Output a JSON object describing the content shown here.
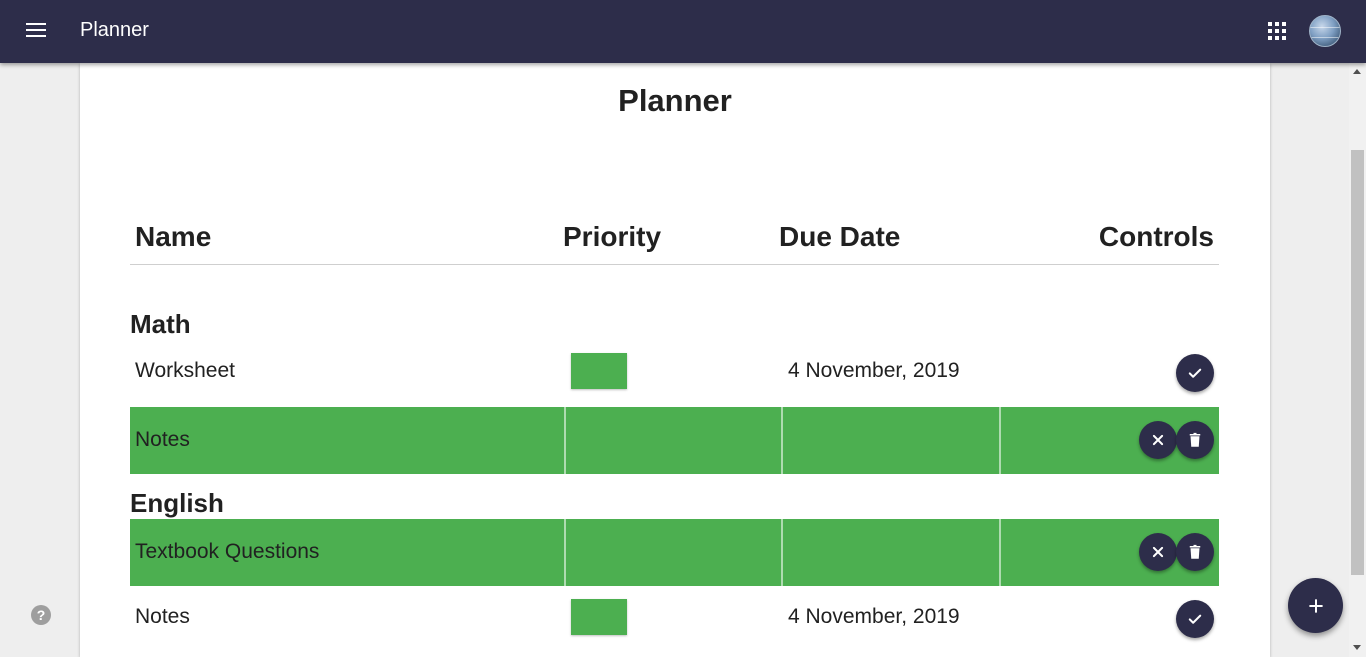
{
  "appbar": {
    "title": "Planner"
  },
  "page": {
    "title": "Planner"
  },
  "table": {
    "headers": {
      "name": "Name",
      "priority": "Priority",
      "due": "Due Date",
      "controls": "Controls"
    }
  },
  "groups": [
    {
      "subject": "Math",
      "tasks": [
        {
          "name": "Worksheet",
          "due": "4 November, 2019",
          "completed": false,
          "priority_color": "#4caf50"
        },
        {
          "name": "Notes",
          "completed": true
        }
      ]
    },
    {
      "subject": "English",
      "tasks": [
        {
          "name": "Textbook Questions",
          "completed": true
        },
        {
          "name": "Notes",
          "due": "4 November, 2019",
          "completed": false,
          "priority_color": "#4caf50"
        }
      ]
    }
  ],
  "help": {
    "label": "?"
  },
  "colors": {
    "appbar": "#2d2d4a",
    "completed_row": "#4caf50",
    "priority_low": "#4caf50",
    "button": "#2d2d4a"
  },
  "icons": [
    "menu-icon",
    "apps-grid-icon",
    "avatar",
    "check-icon",
    "close-icon",
    "trash-icon",
    "add-icon",
    "help-icon"
  ]
}
